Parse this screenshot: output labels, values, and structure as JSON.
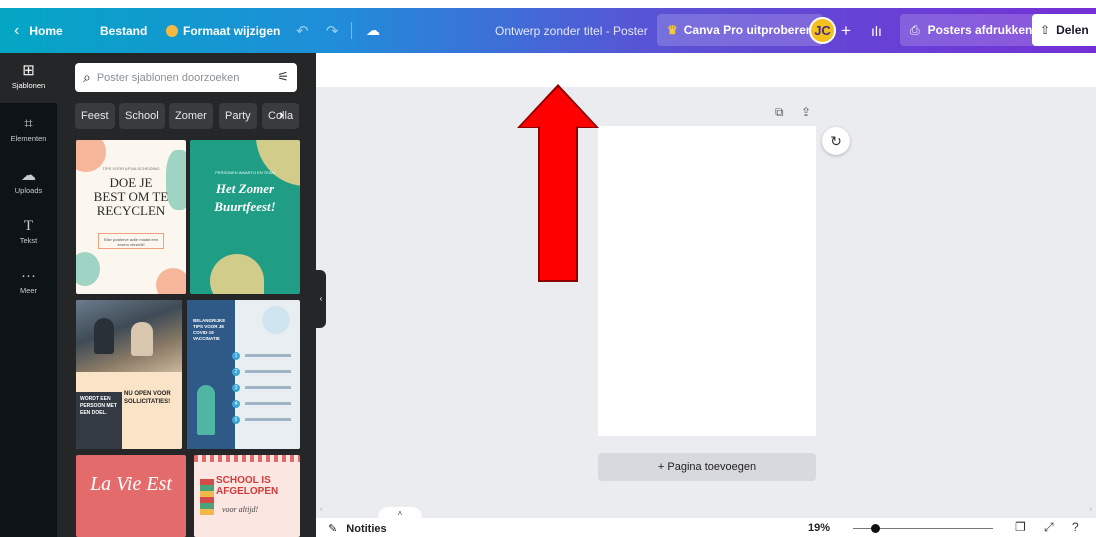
{
  "topbar": {
    "home_label": "Home",
    "file_label": "Bestand",
    "resize_label": "Formaat wijzigen",
    "undo_icon": "undo-icon",
    "redo_icon": "redo-icon",
    "doc_title": "Ontwerp zonder titel - Poster",
    "pro_label": "Canva Pro uitproberen",
    "avatar_initials": "JC",
    "print_label": "Posters afdrukken",
    "share_label": "Delen"
  },
  "rail": {
    "items": [
      {
        "label": "Sjablonen",
        "icon": "templates-icon"
      },
      {
        "label": "Elementen",
        "icon": "elements-icon"
      },
      {
        "label": "Uploads",
        "icon": "upload-cloud-icon"
      },
      {
        "label": "Tekst",
        "icon": "text-icon"
      },
      {
        "label": "Meer",
        "icon": "more-icon"
      }
    ]
  },
  "panel": {
    "search_placeholder": "Poster sjablonen doorzoeken",
    "chips": [
      "Feest",
      "School",
      "Zomer",
      "Party",
      "Colla"
    ]
  },
  "templates": {
    "t1": {
      "top": "TIPS VOOR AFVALSCHEIDING",
      "title_line1": "DOE JE",
      "title_line2": "BEST OM TE",
      "title_line3": "RECYCLEN",
      "box": "Elke positieve actie maakt een enorm verschil!"
    },
    "t2": {
      "top": "PERSONEN WAARTIJ EN TEAM",
      "title_line1": "Het Zomer",
      "title_line2": "Buurtfeest!"
    },
    "t3": {
      "dark": "WORDT EEN PERSOON MET EEN DOEL.",
      "head": "NU OPEN VOOR SOLLICITATIES!"
    },
    "t4": {
      "head": "BELANGRIJKE TIPS VOOR JE COVID-19 VACCINATIE"
    },
    "t5": {
      "script": "La Vie Est"
    },
    "t6": {
      "head": "SCHOOL IS AFGELOPEN",
      "script": "voor altijd!"
    }
  },
  "canvas": {
    "add_page_label": "+ Pagina toevoegen"
  },
  "bottombar": {
    "notes_label": "Notities",
    "zoom_label": "19%",
    "zoom_value": 19
  },
  "colors": {
    "gradient_start": "#04a6c4",
    "gradient_end": "#7430d6",
    "annotation_arrow": "#ff0000"
  }
}
